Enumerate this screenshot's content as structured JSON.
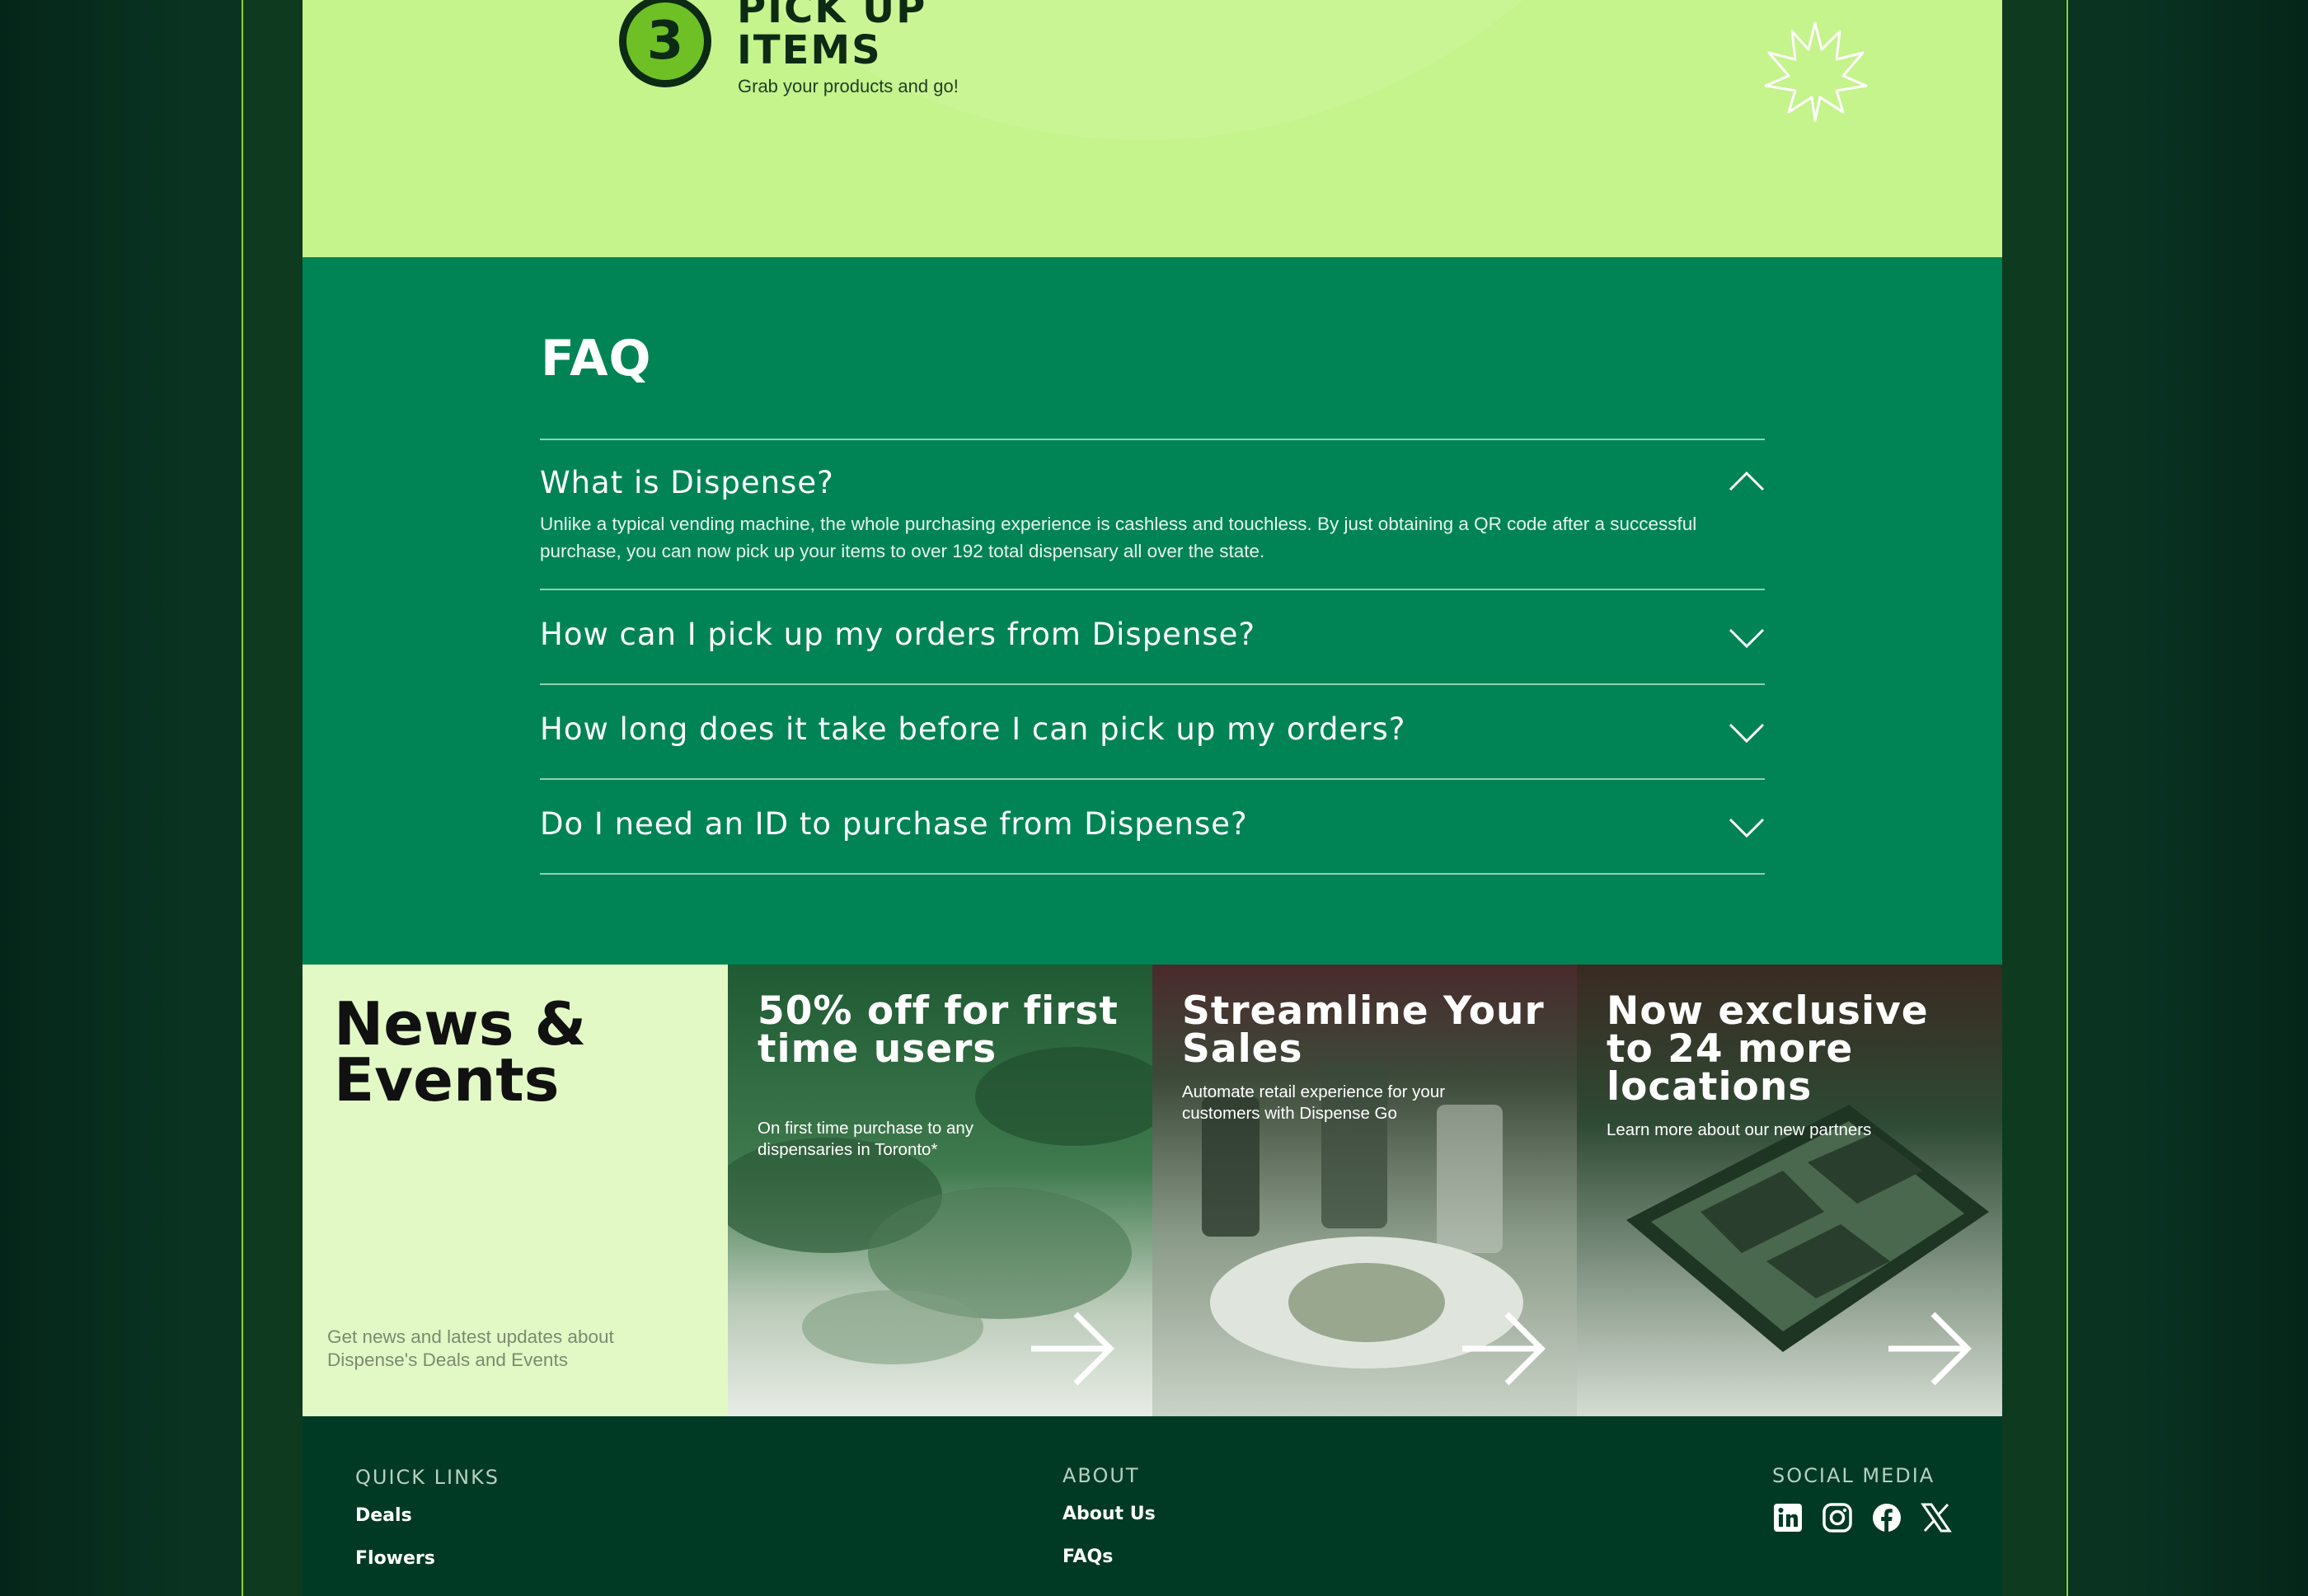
{
  "step": {
    "number": "3",
    "title_line1": "PICK UP",
    "title_line2": "ITEMS",
    "subtitle": "Grab your products and go!"
  },
  "faq": {
    "title": "FAQ",
    "items": [
      {
        "question": "What is Dispense?",
        "answer": "Unlike a typical vending machine, the whole purchasing experience is cashless and touchless. By just obtaining a QR code after a successful purchase, you can now pick up your items to over 192 total dispensary all over the state.",
        "expanded": true
      },
      {
        "question": "How can I pick up my orders from Dispense?",
        "expanded": false
      },
      {
        "question": "How long does it take before I can pick up my orders?",
        "expanded": false
      },
      {
        "question": "Do I need an ID to purchase from Dispense?",
        "expanded": false
      }
    ]
  },
  "news": {
    "title_line1": "News &",
    "title_line2": "Events",
    "description": "Get news and latest updates about Dispense's Deals and Events",
    "cards": [
      {
        "title": "50% off for first time users",
        "subtitle": "On first time purchase to any dispensaries in Toronto*"
      },
      {
        "title": "Streamline Your Sales",
        "subtitle": "Automate retail experience for your customers with Dispense Go"
      },
      {
        "title": "Now exclusive to 24 more locations",
        "subtitle": "Learn more about our new partners"
      }
    ]
  },
  "footer": {
    "quick_links": {
      "heading": "QUICK LINKS",
      "items": [
        "Deals",
        "Flowers"
      ]
    },
    "about": {
      "heading": "ABOUT",
      "items": [
        "About Us",
        "FAQs"
      ]
    },
    "social": {
      "heading": "SOCIAL MEDIA",
      "icons": [
        "linkedin-icon",
        "instagram-icon",
        "facebook-icon",
        "x-icon"
      ]
    }
  },
  "colors": {
    "hero": "#c5f38c",
    "faq_bg": "#008455",
    "news_intro_bg": "#e2f9c6",
    "footer_bg": "#003a25",
    "frame_border": "#8bd12d"
  }
}
